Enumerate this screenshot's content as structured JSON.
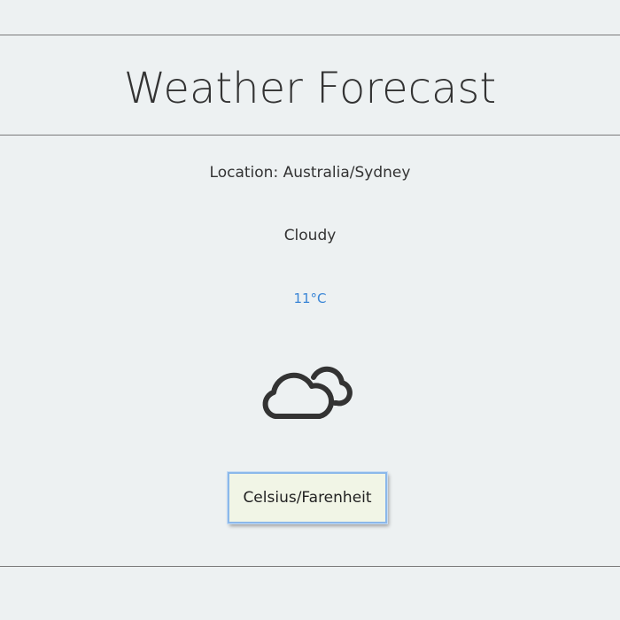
{
  "header": {
    "title": "Weather Forecast"
  },
  "weather": {
    "location": "Location: Australia/Sydney",
    "condition": "Cloudy",
    "temperature": "11°C",
    "icon": "cloudy-icon"
  },
  "controls": {
    "toggle_label": "Celsius/Farenheit"
  },
  "colors": {
    "background": "#edf1f2",
    "text": "#333333",
    "temperature": "#3b86d6",
    "button_bg": "#f1f5e6",
    "button_border": "#8bb8ea"
  }
}
